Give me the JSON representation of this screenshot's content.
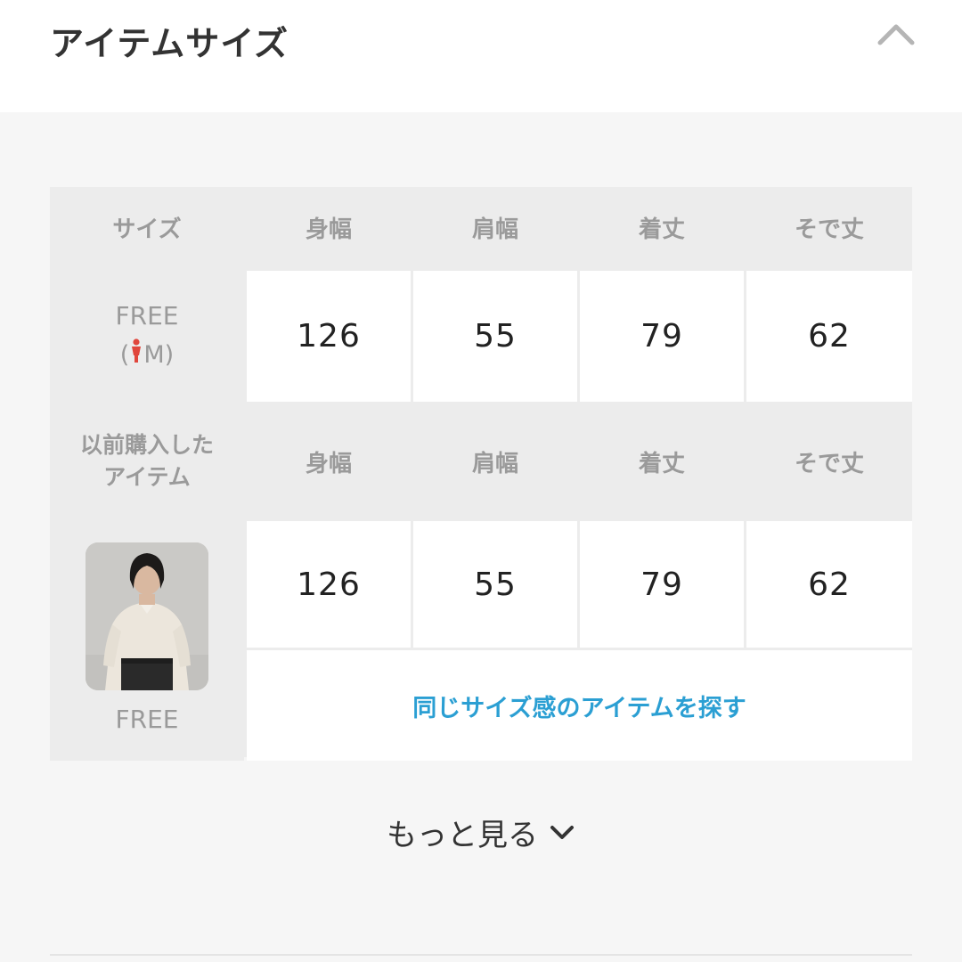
{
  "section": {
    "title": "アイテムサイズ",
    "collapse_icon": "chevron-up-icon"
  },
  "table": {
    "headers": [
      "サイズ",
      "身幅",
      "肩幅",
      "着丈",
      "そで丈"
    ],
    "row1": {
      "size": "FREE",
      "model_open": "(",
      "model_size": "M",
      "model_close": ")",
      "model_icon": "person-icon",
      "values": [
        "126",
        "55",
        "79",
        "62"
      ]
    },
    "previous": {
      "label_line1": "以前購入した",
      "label_line2": "アイテム",
      "headers": [
        "身幅",
        "肩幅",
        "着丈",
        "そで丈"
      ],
      "values": [
        "126",
        "55",
        "79",
        "62"
      ],
      "size": "FREE",
      "link": "同じサイズ感のアイテムを探す"
    }
  },
  "more": {
    "label": "もっと見る",
    "icon": "chevron-down-icon"
  },
  "colors": {
    "link": "#2b9fd3",
    "model_icon": "#e0463c",
    "header_bg": "#ececec"
  }
}
